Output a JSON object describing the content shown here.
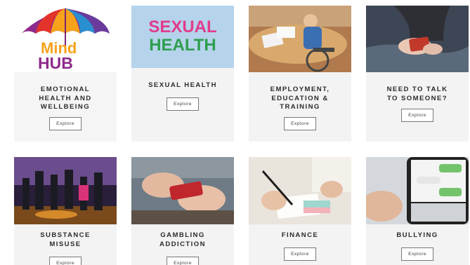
{
  "cards": [
    {
      "title_lines": [
        "Emotional",
        "Health and",
        "Wellbeing"
      ],
      "logo_text": [
        "Mind",
        "HUB"
      ],
      "button": "Explore"
    },
    {
      "title_lines": [
        "Sexual Health"
      ],
      "logo_text": [
        "SEXUAL",
        "HEALTH"
      ],
      "button": "Explore"
    },
    {
      "title_lines": [
        "Employment,",
        "Education &",
        "Training"
      ],
      "button": "Explore"
    },
    {
      "title_lines": [
        "Need to Talk",
        "to Someone?"
      ],
      "button": "Explore"
    },
    {
      "title_lines": [
        "Substance",
        "Misuse"
      ],
      "button": "Explore"
    },
    {
      "title_lines": [
        "Gambling",
        "Addiction"
      ],
      "button": "Explore"
    },
    {
      "title_lines": [
        "Finance"
      ],
      "button": "Explore"
    },
    {
      "title_lines": [
        "Bullying"
      ],
      "button": "Explore"
    }
  ]
}
